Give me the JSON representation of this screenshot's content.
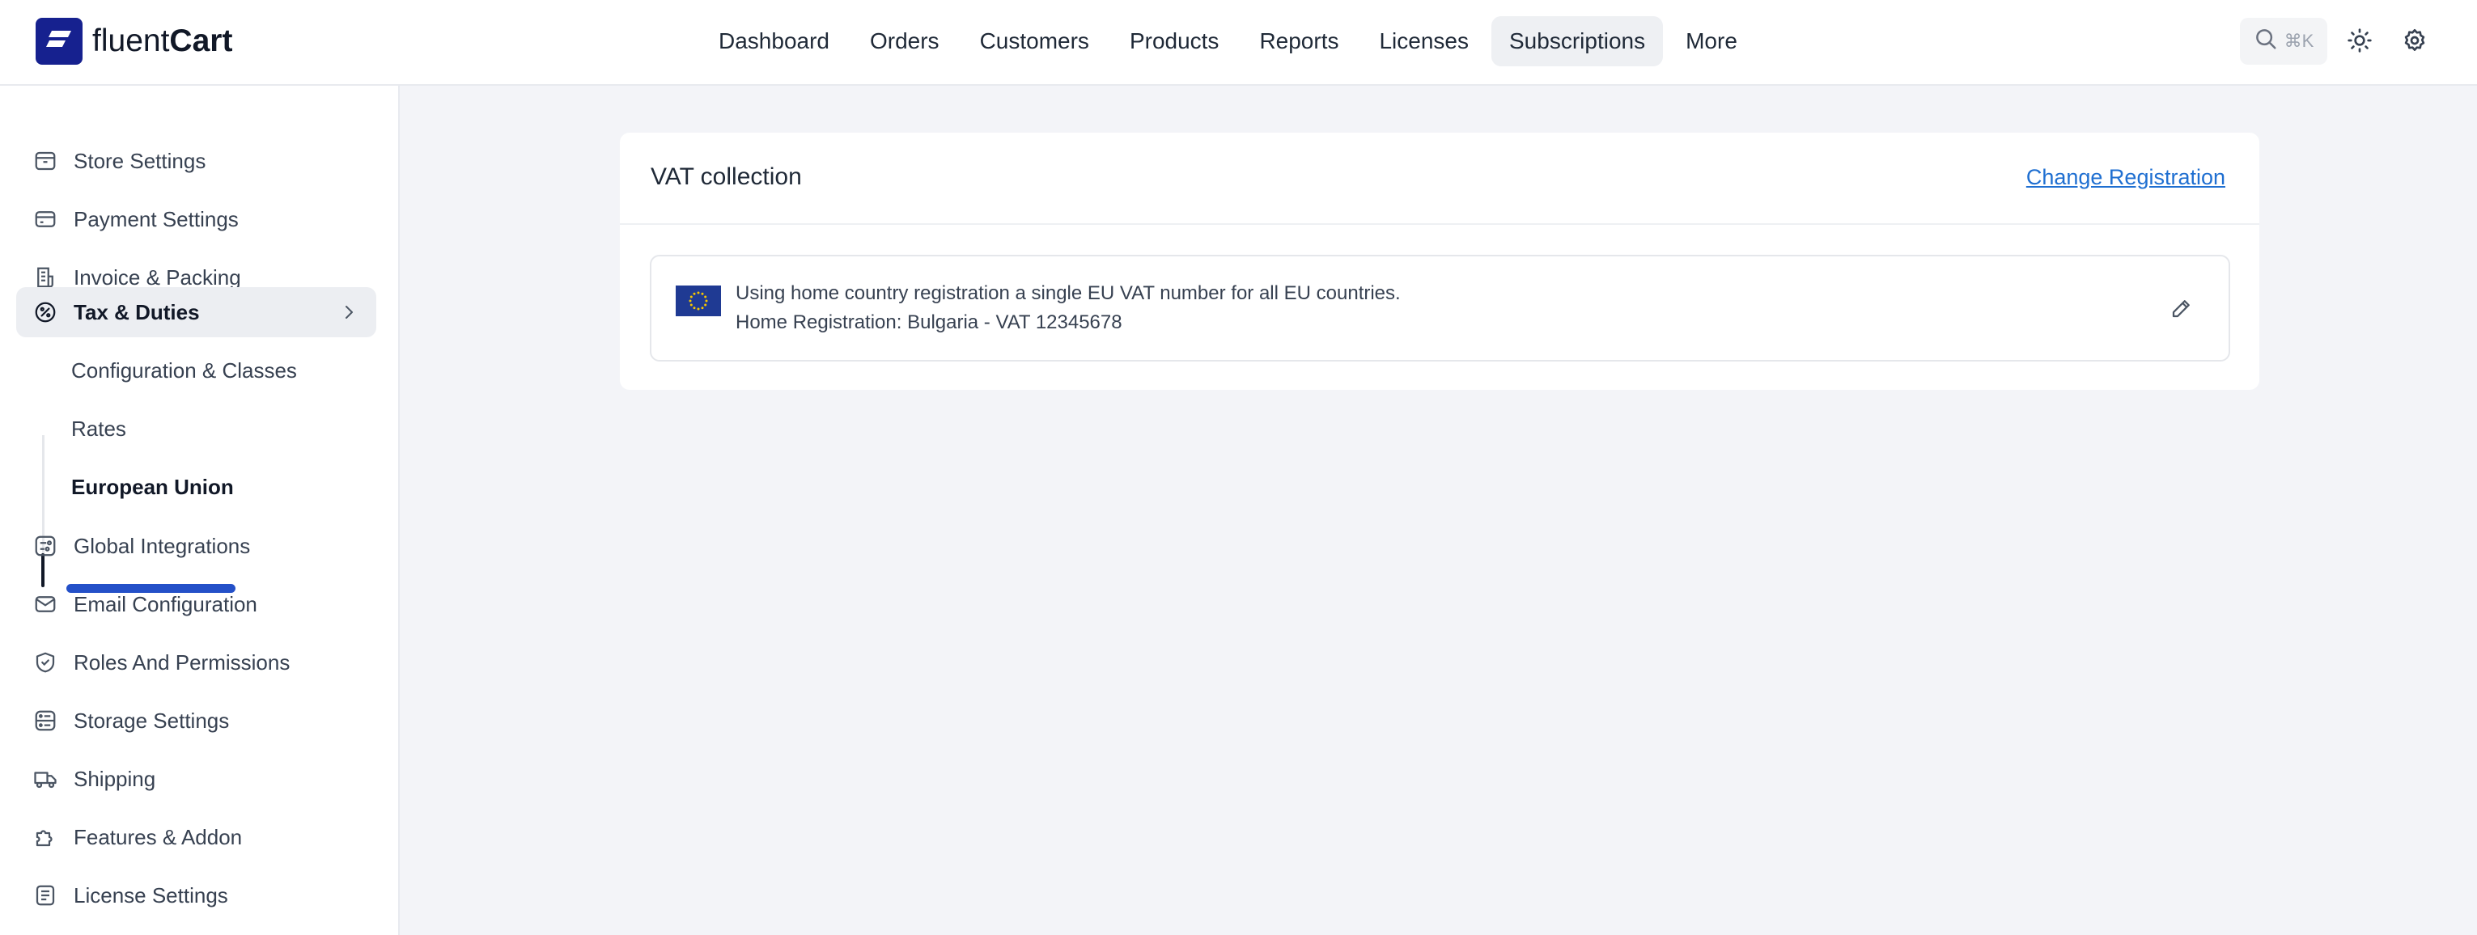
{
  "app": {
    "logo_light": "fluent",
    "logo_bold": "Cart"
  },
  "nav": {
    "items": [
      {
        "label": "Dashboard"
      },
      {
        "label": "Orders"
      },
      {
        "label": "Customers"
      },
      {
        "label": "Products"
      },
      {
        "label": "Reports"
      },
      {
        "label": "Licenses"
      },
      {
        "label": "Subscriptions",
        "active": true
      },
      {
        "label": "More"
      }
    ]
  },
  "search": {
    "shortcut": "⌘K",
    "icon": "search-icon"
  },
  "toolbar_icons": [
    "sun-icon",
    "gear-icon"
  ],
  "sidebar": {
    "items": [
      {
        "label": "Store Settings",
        "icon": "store-icon"
      },
      {
        "label": "Payment Settings",
        "icon": "card-icon"
      },
      {
        "label": "Invoice & Packing",
        "icon": "invoice-icon"
      },
      {
        "label": "Tax & Duties",
        "icon": "percent-icon",
        "open": true
      },
      {
        "label": "Global Integrations",
        "icon": "integrations-icon"
      },
      {
        "label": "Email Configuration",
        "icon": "mail-icon"
      },
      {
        "label": "Roles And Permissions",
        "icon": "shield-icon"
      },
      {
        "label": "Storage Settings",
        "icon": "storage-icon"
      },
      {
        "label": "Shipping",
        "icon": "truck-icon"
      },
      {
        "label": "Features & Addon",
        "icon": "puzzle-icon"
      },
      {
        "label": "License Settings",
        "icon": "license-icon"
      }
    ],
    "subitems": [
      {
        "label": "Configuration & Classes"
      },
      {
        "label": "Rates"
      },
      {
        "label": "European Union",
        "active": true
      }
    ]
  },
  "card": {
    "title": "VAT collection",
    "link": "Change Registration",
    "info_line1": "Using home country registration a single EU VAT number for all EU countries.",
    "info_line2": "Home Registration: Bulgaria - VAT 12345678"
  },
  "colors": {
    "brand": "#16218f",
    "link": "#1f6fd1",
    "highlight": "#2450c8"
  }
}
